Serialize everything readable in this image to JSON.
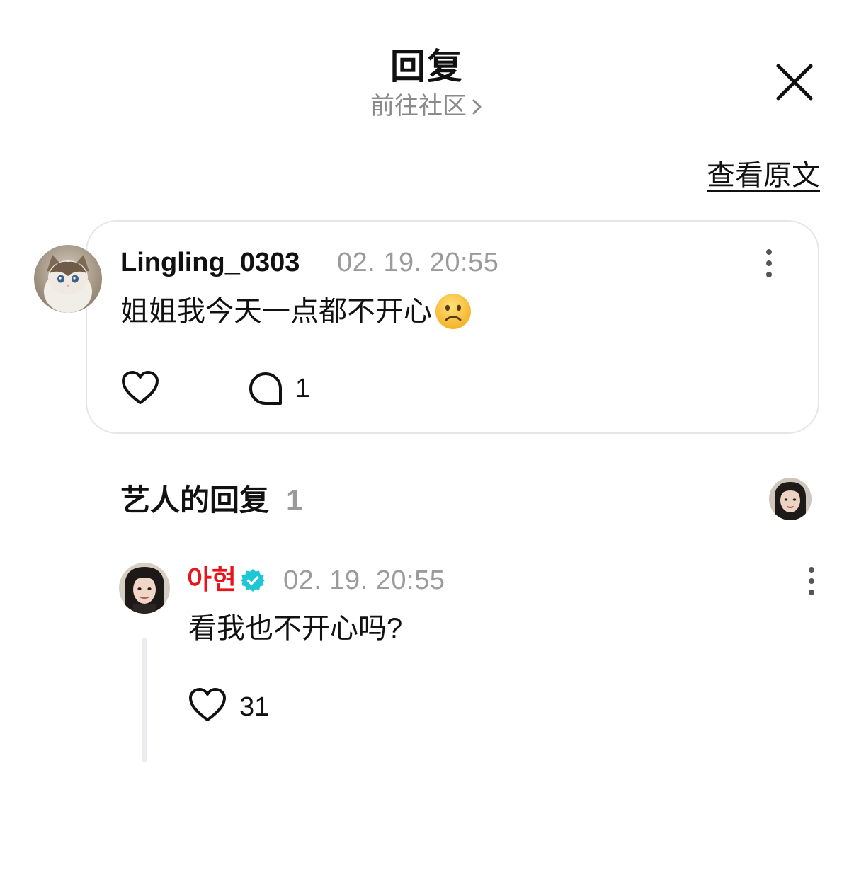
{
  "header": {
    "title": "回复",
    "subtitle": "前往社区"
  },
  "view_original": "查看原文",
  "comment": {
    "username": "Lingling_0303",
    "timestamp": "02. 19. 20:55",
    "text": "姐姐我今天一点都不开心",
    "emoji": "☹️",
    "reply_count": "1"
  },
  "artist_replies": {
    "title": "艺人的回复",
    "count": "1"
  },
  "reply": {
    "name": "아현",
    "timestamp": "02. 19. 20:55",
    "text": "看我也不开心吗?",
    "like_count": "31"
  },
  "colors": {
    "artist_name": "#e8141c",
    "verified_badge": "#1fc6d6",
    "muted_text": "#9b9b9b",
    "card_border": "#e6e6e9"
  },
  "icons": [
    "chevron-right-icon",
    "close-icon",
    "more-vertical-icon",
    "heart-icon",
    "chat-bubble-icon",
    "verified-badge-icon"
  ]
}
